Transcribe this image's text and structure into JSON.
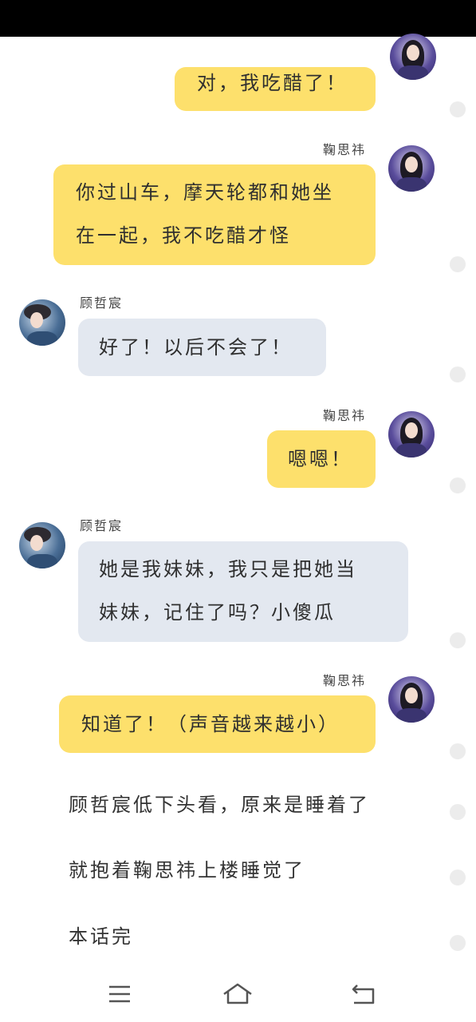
{
  "messages": [
    {
      "side": "right",
      "sender": "",
      "text_lines": [
        "对，我吃醋了！"
      ]
    },
    {
      "side": "right",
      "sender": "鞠思祎",
      "text_lines": [
        "你过山车，摩天轮都和她坐",
        "在一起，我不吃醋才怪"
      ]
    },
    {
      "side": "left",
      "sender": "顾哲宸",
      "text_lines": [
        "好了！以后不会了！"
      ]
    },
    {
      "side": "right",
      "sender": "鞠思祎",
      "text_lines": [
        "嗯嗯！"
      ]
    },
    {
      "side": "left",
      "sender": "顾哲宸",
      "text_lines": [
        "她是我妹妹，我只是把她当",
        "妹妹，记住了吗？小傻瓜"
      ]
    },
    {
      "side": "right",
      "sender": "鞠思祎",
      "text_lines": [
        "知道了！（声音越来越小）"
      ]
    }
  ],
  "narration": [
    "顾哲宸低下头看，原来是睡着了",
    "就抱着鞠思祎上楼睡觉了",
    "本话完"
  ],
  "nav": {
    "menu_icon": "menu-icon",
    "home_icon": "home-icon",
    "back_icon": "back-icon"
  },
  "colors": {
    "right_bubble": "#fde06c",
    "left_bubble": "#e3e8f0",
    "status_bar": "#000000"
  }
}
